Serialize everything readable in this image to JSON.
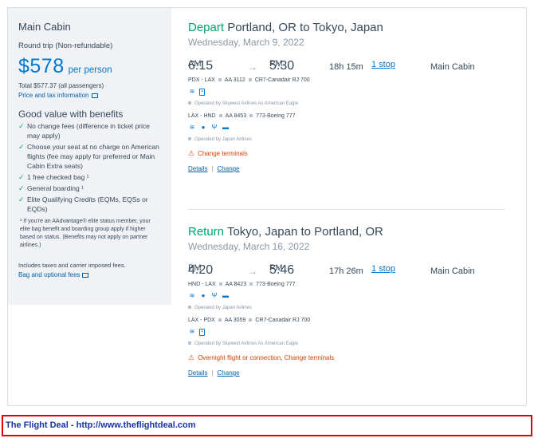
{
  "sidebar": {
    "cabin": "Main Cabin",
    "trip": "Round trip (Non-refundable)",
    "price": "$578",
    "per_person": "per person",
    "total": "Total $577.37 (all passengers)",
    "price_tax_link": "Price and tax information",
    "good_value": "Good value with benefits",
    "benefits": [
      "No change fees (difference in ticket price may apply)",
      "Choose your seat at no charge on American flights (fee may apply for preferred or Main Cabin Extra seats)",
      "1 free checked bag ¹",
      "General boarding ¹",
      "Elite Qualifying Credits (EQMs, EQSs or EQDs)"
    ],
    "fine_print": "¹ If you're an AAdvantage® elite status member, your elite bag benefit and boarding group apply if higher based on status. (Benefits may not apply on partner airlines.)",
    "includes": "Includes taxes and carrier imposed fees.",
    "bag_link": "Bag and optional fees"
  },
  "depart": {
    "label": "Depart",
    "route": "Portland, OR to Tokyo, Japan",
    "date": "Wednesday, March 9, 2022",
    "dep_time": "6:15",
    "dep_ampm": "AM",
    "arr_time": "5:30",
    "arr_ampm": "PM",
    "duration": "18h 15m",
    "stops": "1 stop",
    "cabin": "Main Cabin",
    "legs": [
      {
        "route": "PDX - LAX",
        "flight": "AA 3112",
        "aircraft": "CR7-Canadair RJ 700",
        "operated": "Operated by Skywest Airlines As American Eagle",
        "amenities": [
          "wifi-icon",
          "power-icon"
        ]
      },
      {
        "route": "LAX - HND",
        "flight": "AA 8453",
        "aircraft": "773-Boeing 777",
        "operated": "Operated by Japan Airlines",
        "amenities": [
          "wifi-icon",
          "entertainment-icon",
          "usb-icon",
          "tv-icon"
        ]
      }
    ],
    "warning": "Change terminals",
    "details": "Details",
    "change": "Change"
  },
  "return": {
    "label": "Return",
    "route": "Tokyo, Japan to Portland, OR",
    "date": "Wednesday, March 16, 2022",
    "dep_time": "4:20",
    "dep_ampm": "PM",
    "arr_time": "5:46",
    "arr_ampm": "PM",
    "duration": "17h 26m",
    "stops": "1 stop",
    "cabin": "Main Cabin",
    "legs": [
      {
        "route": "HND - LAX",
        "flight": "AA 8423",
        "aircraft": "773-Boeing 777",
        "operated": "Operated by Japan Airlines",
        "amenities": [
          "wifi-icon",
          "entertainment-icon",
          "usb-icon",
          "tv-icon"
        ]
      },
      {
        "route": "LAX - PDX",
        "flight": "AA 3059",
        "aircraft": "CR7-Canadair RJ 700",
        "operated": "Operated by Skywest Airlines As American Eagle",
        "amenities": [
          "wifi-icon",
          "power-icon"
        ]
      }
    ],
    "warning": "Overnight flight or connection, Change terminals",
    "details": "Details",
    "change": "Change"
  },
  "footer": "The Flight Deal - http://www.theflightdeal.com",
  "colors": {
    "accent": "#0078d2",
    "green": "#00a46b",
    "warning": "#d14200",
    "footer_border": "#e20000"
  }
}
